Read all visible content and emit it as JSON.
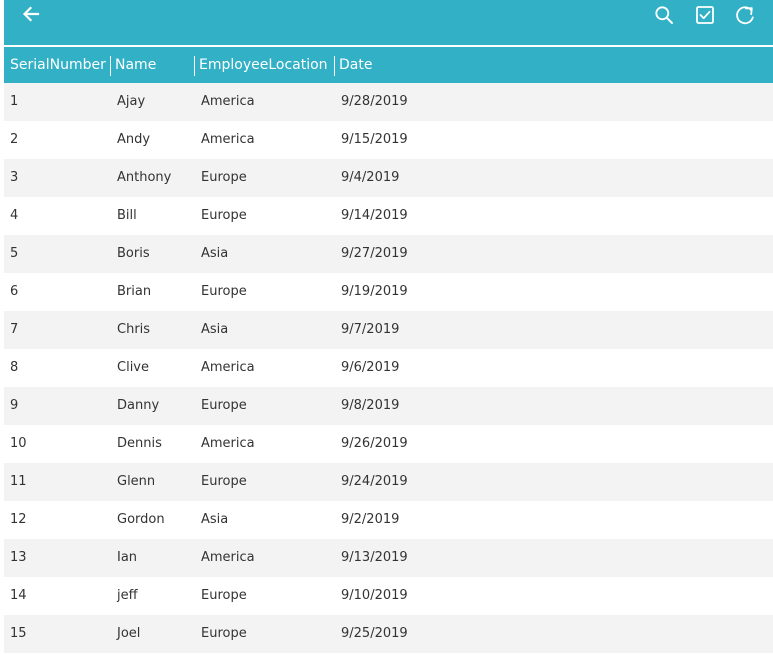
{
  "toolbar": {
    "accent_color": "#31b0c6",
    "icons": [
      "arrow-left-icon",
      "search-icon",
      "checkbox-checked-icon",
      "refresh-icon"
    ]
  },
  "grid": {
    "columns": [
      "SerialNumber",
      "Name",
      "EmployeeLocation",
      "Date"
    ],
    "rows": [
      {
        "serial": "1",
        "name": "Ajay",
        "location": "America",
        "date": "9/28/2019"
      },
      {
        "serial": "2",
        "name": "Andy",
        "location": "America",
        "date": "9/15/2019"
      },
      {
        "serial": "3",
        "name": "Anthony",
        "location": "Europe",
        "date": "9/4/2019"
      },
      {
        "serial": "4",
        "name": "Bill",
        "location": "Europe",
        "date": "9/14/2019"
      },
      {
        "serial": "5",
        "name": "Boris",
        "location": "Asia",
        "date": "9/27/2019"
      },
      {
        "serial": "6",
        "name": "Brian",
        "location": "Europe",
        "date": "9/19/2019"
      },
      {
        "serial": "7",
        "name": "Chris",
        "location": "Asia",
        "date": "9/7/2019"
      },
      {
        "serial": "8",
        "name": "Clive",
        "location": "America",
        "date": "9/6/2019"
      },
      {
        "serial": "9",
        "name": "Danny",
        "location": "Europe",
        "date": "9/8/2019"
      },
      {
        "serial": "10",
        "name": "Dennis",
        "location": "America",
        "date": "9/26/2019"
      },
      {
        "serial": "11",
        "name": "Glenn",
        "location": "Europe",
        "date": "9/24/2019"
      },
      {
        "serial": "12",
        "name": "Gordon",
        "location": "Asia",
        "date": "9/2/2019"
      },
      {
        "serial": "13",
        "name": "Ian",
        "location": "America",
        "date": "9/13/2019"
      },
      {
        "serial": "14",
        "name": "jeff",
        "location": "Europe",
        "date": "9/10/2019"
      },
      {
        "serial": "15",
        "name": "Joel",
        "location": "Europe",
        "date": "9/25/2019"
      }
    ]
  }
}
